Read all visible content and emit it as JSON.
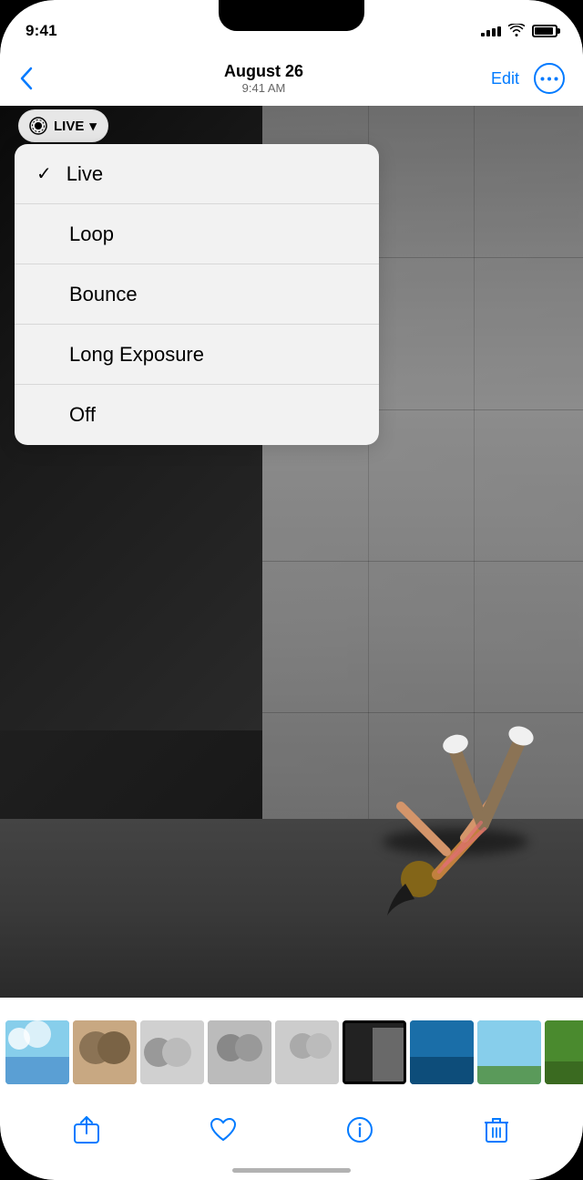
{
  "statusBar": {
    "time": "9:41",
    "signalBars": [
      4,
      7,
      9,
      11,
      13
    ],
    "battery": 90
  },
  "navBar": {
    "backLabel": "‹",
    "title": "August 26",
    "subtitle": "9:41 AM",
    "editLabel": "Edit",
    "moreLabel": "···"
  },
  "liveButton": {
    "label": "LIVE",
    "chevron": "▾"
  },
  "dropdown": {
    "items": [
      {
        "id": "live",
        "label": "Live",
        "selected": true
      },
      {
        "id": "loop",
        "label": "Loop",
        "selected": false
      },
      {
        "id": "bounce",
        "label": "Bounce",
        "selected": false
      },
      {
        "id": "long-exposure",
        "label": "Long Exposure",
        "selected": false
      },
      {
        "id": "off",
        "label": "Off",
        "selected": false
      }
    ]
  },
  "actionBar": {
    "share": "⬆",
    "like": "♡",
    "info": "ⓘ",
    "trash": "🗑"
  }
}
